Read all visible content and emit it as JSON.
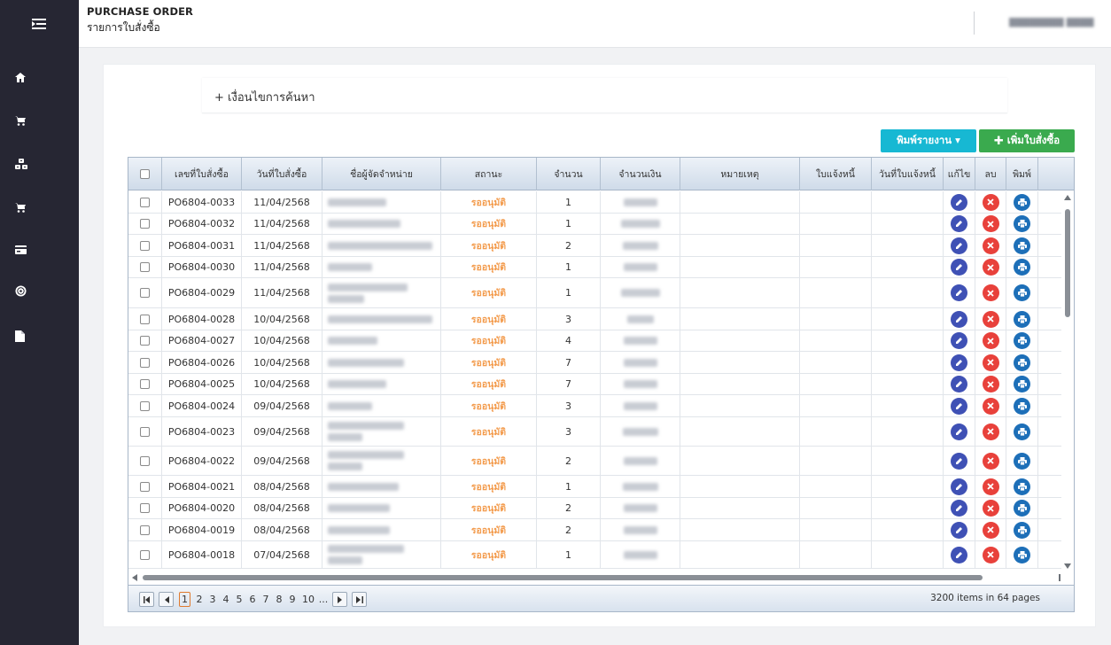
{
  "sidebar": {
    "icons": [
      "menu-toggle-icon",
      "home-icon",
      "cart-icon",
      "boxes-icon",
      "cart-icon",
      "card-icon",
      "settings-icon",
      "document-icon"
    ]
  },
  "header": {
    "title_en": "PURCHASE ORDER",
    "title_th": "รายการใบสั่งซื้อ",
    "user_name": "████████ ████"
  },
  "search": {
    "label": "+ เงื่อนไขการค้นหา"
  },
  "toolbar": {
    "print_label": "พิมพ์รายงาน ▾",
    "add_label": "เพิ่มใบสั่งซื้อ"
  },
  "table": {
    "columns": [
      "",
      "เลขที่ใบสั่งซื้อ",
      "วันที่ใบสั่งซื้อ",
      "ชื่อผู้จัดจำหน่าย",
      "สถานะ",
      "จำนวน",
      "จำนวนเงิน",
      "หมายเหตุ",
      "ใบแจ้งหนี้",
      "วันที่ใบแจ้งหนี้",
      "แก้ไข",
      "ลบ",
      "พิมพ์"
    ],
    "rows": [
      {
        "po": "PO6804-0033",
        "date": "11/04/2568",
        "status": "รออนุมัติ",
        "qty": "1"
      },
      {
        "po": "PO6804-0032",
        "date": "11/04/2568",
        "status": "รออนุมัติ",
        "qty": "1"
      },
      {
        "po": "PO6804-0031",
        "date": "11/04/2568",
        "status": "รออนุมัติ",
        "qty": "2"
      },
      {
        "po": "PO6804-0030",
        "date": "11/04/2568",
        "status": "รออนุมัติ",
        "qty": "1"
      },
      {
        "po": "PO6804-0029",
        "date": "11/04/2568",
        "status": "รออนุมัติ",
        "qty": "1"
      },
      {
        "po": "PO6804-0028",
        "date": "10/04/2568",
        "status": "รออนุมัติ",
        "qty": "3"
      },
      {
        "po": "PO6804-0027",
        "date": "10/04/2568",
        "status": "รออนุมัติ",
        "qty": "4"
      },
      {
        "po": "PO6804-0026",
        "date": "10/04/2568",
        "status": "รออนุมัติ",
        "qty": "7"
      },
      {
        "po": "PO6804-0025",
        "date": "10/04/2568",
        "status": "รออนุมัติ",
        "qty": "7"
      },
      {
        "po": "PO6804-0024",
        "date": "09/04/2568",
        "status": "รออนุมัติ",
        "qty": "3"
      },
      {
        "po": "PO6804-0023",
        "date": "09/04/2568",
        "status": "รออนุมัติ",
        "qty": "3"
      },
      {
        "po": "PO6804-0022",
        "date": "09/04/2568",
        "status": "รออนุมัติ",
        "qty": "2"
      },
      {
        "po": "PO6804-0021",
        "date": "08/04/2568",
        "status": "รออนุมัติ",
        "qty": "1"
      },
      {
        "po": "PO6804-0020",
        "date": "08/04/2568",
        "status": "รออนุมัติ",
        "qty": "2"
      },
      {
        "po": "PO6804-0019",
        "date": "08/04/2568",
        "status": "รออนุมัติ",
        "qty": "2"
      },
      {
        "po": "PO6804-0018",
        "date": "07/04/2568",
        "status": "รออนุมัติ",
        "qty": "1"
      }
    ]
  },
  "pager": {
    "pages": [
      "1",
      "2",
      "3",
      "4",
      "5",
      "6",
      "7",
      "8",
      "9",
      "10",
      "..."
    ],
    "current": "1",
    "info": "3200 items in 64 pages"
  },
  "colors": {
    "sidebar_bg": "#262633",
    "status_pending": "#f39c4e",
    "print_button": "#17b8d3",
    "add_button": "#3aaa4e",
    "edit_action": "#3f51b5",
    "delete_action": "#e8413b",
    "print_action": "#1d6fb8"
  }
}
